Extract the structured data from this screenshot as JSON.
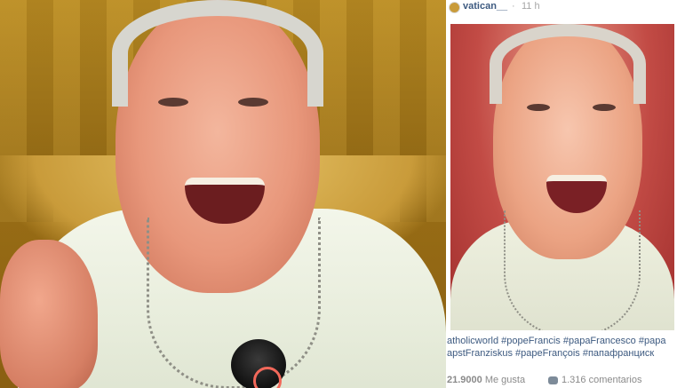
{
  "post": {
    "username": "vatican__",
    "separator": "·",
    "time": "11 h"
  },
  "caption": {
    "line1": "atholicworld #popeFrancis #papaFrancesco #papa",
    "line2": "apstFranziskus #papeFrançois #папафранциск"
  },
  "footer": {
    "likes_count": "21.9000",
    "likes_label": "Me gusta",
    "comments": "1.316 comentarios"
  },
  "icons": {
    "comment": "speech-bubble-icon"
  },
  "colors": {
    "username": "#3d5a80",
    "hashtags": "#3d5a80",
    "meta": "#a6a6a6"
  }
}
